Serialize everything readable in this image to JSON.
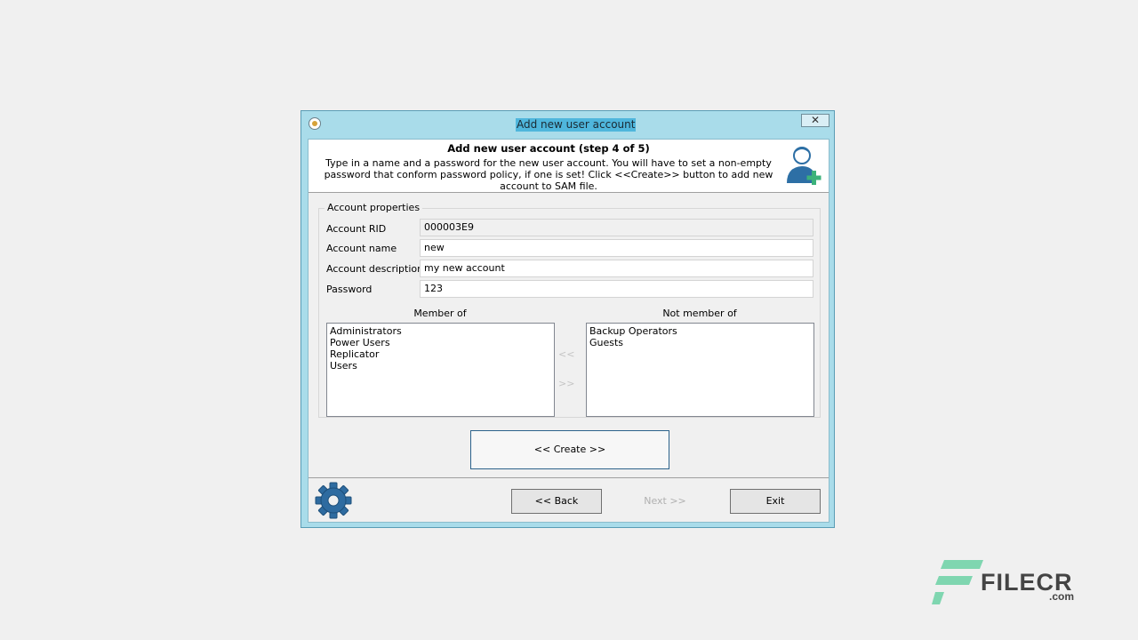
{
  "window": {
    "title": "Add new user account",
    "close_label": "✕"
  },
  "header": {
    "title": "Add new user account (step 4 of 5)",
    "description": "Type in a name and a password for the new user account. You will have to set a non-empty password that conform password policy, if one is set! Click <<Create>> button to add new account to SAM file."
  },
  "account_properties": {
    "group_label": "Account properties",
    "rid_label": "Account RID",
    "rid_value": "000003E9",
    "name_label": "Account name",
    "name_value": "new",
    "description_label": "Account description",
    "description_value": "my new account",
    "password_label": "Password",
    "password_value": "123"
  },
  "membership": {
    "member_of_label": "Member of",
    "not_member_of_label": "Not member of",
    "member_of": [
      "Administrators",
      "Power Users",
      "Replicator",
      "Users"
    ],
    "not_member_of": [
      "Backup Operators",
      "Guests"
    ],
    "add_label": "<<",
    "remove_label": ">>"
  },
  "create_button": "<<  Create  >>",
  "footer": {
    "back_label": "<< Back",
    "next_label": "Next >>",
    "exit_label": "Exit"
  },
  "watermark": {
    "brand": "FILECR",
    "suffix": ".com"
  },
  "colors": {
    "frame": "#a9dcea",
    "title_highlight": "#4fb6dc",
    "accent_blue": "#2c628b",
    "plus_green": "#3cb27a"
  },
  "icons": {
    "app": "app-icon",
    "user_add": "user-add-icon",
    "gear": "gear-icon"
  }
}
